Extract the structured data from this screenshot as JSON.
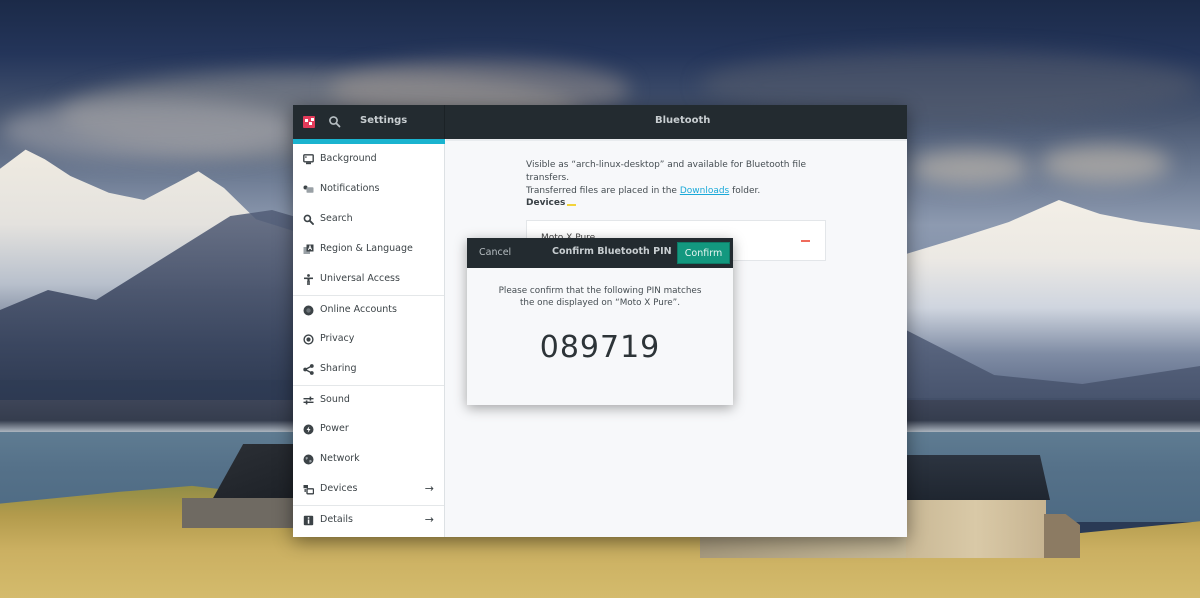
{
  "window": {
    "app_title": "Settings",
    "panel_title": "Bluetooth",
    "bluetooth_enabled": true,
    "accent_color": "#1ab3cf"
  },
  "sidebar": {
    "items": [
      {
        "label": "Background",
        "icon": "monitor-icon",
        "has_arrow": false
      },
      {
        "label": "Notifications",
        "icon": "notifications-icon",
        "has_arrow": false
      },
      {
        "label": "Search",
        "icon": "search-icon",
        "has_arrow": false
      },
      {
        "label": "Region & Language",
        "icon": "region-language-icon",
        "has_arrow": false
      },
      {
        "label": "Universal Access",
        "icon": "accessibility-icon",
        "has_arrow": false
      },
      {
        "label": "Online Accounts",
        "icon": "online-accounts-icon",
        "has_arrow": false
      },
      {
        "label": "Privacy",
        "icon": "privacy-icon",
        "has_arrow": false
      },
      {
        "label": "Sharing",
        "icon": "share-icon",
        "has_arrow": false
      },
      {
        "label": "Sound",
        "icon": "sound-icon",
        "has_arrow": false
      },
      {
        "label": "Power",
        "icon": "power-icon",
        "has_arrow": false
      },
      {
        "label": "Network",
        "icon": "network-icon",
        "has_arrow": false
      },
      {
        "label": "Devices",
        "icon": "devices-icon",
        "has_arrow": true
      },
      {
        "label": "Details",
        "icon": "info-icon",
        "has_arrow": true
      }
    ],
    "arrow_glyph": "→"
  },
  "main": {
    "description_line1": "Visible as “arch-linux-desktop” and available for Bluetooth file transfers.",
    "description_line2_prefix": "Transferred files are placed in the ",
    "description_link": "Downloads",
    "description_line2_suffix": " folder.",
    "devices_heading": "Devices",
    "devices": [
      {
        "name": "Moto X Pure",
        "status_color": "#ef6b5c"
      }
    ]
  },
  "dialog": {
    "cancel_label": "Cancel",
    "title": "Confirm Bluetooth PIN",
    "confirm_label": "Confirm",
    "message_line1": "Please confirm that the following PIN matches",
    "message_line2": "the one displayed on “Moto X Pure”.",
    "pin": "089719",
    "confirm_color": "#13987f"
  }
}
